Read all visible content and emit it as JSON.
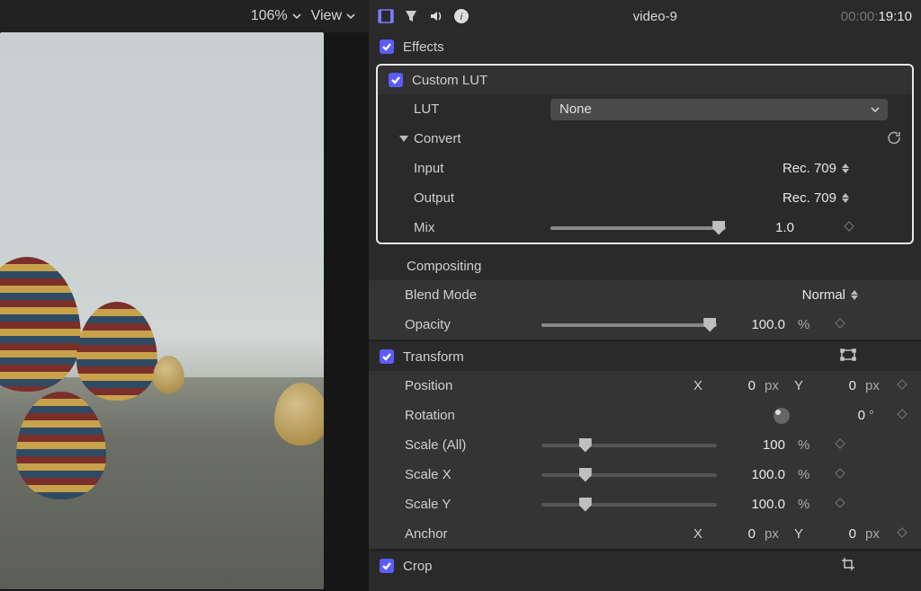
{
  "viewer": {
    "zoom": "106%",
    "view_label": "View"
  },
  "header": {
    "title": "video-9",
    "time_inactive": "00:00:",
    "time_active": "19:10"
  },
  "effects": {
    "section": "Effects",
    "custom_lut": {
      "title": "Custom LUT",
      "lut_label": "LUT",
      "lut_value": "None",
      "convert_label": "Convert",
      "input_label": "Input",
      "input_value": "Rec. 709",
      "output_label": "Output",
      "output_value": "Rec. 709",
      "mix_label": "Mix",
      "mix_value": "1.0"
    }
  },
  "compositing": {
    "title": "Compositing",
    "blend_label": "Blend Mode",
    "blend_value": "Normal",
    "opacity_label": "Opacity",
    "opacity_value": "100.0",
    "opacity_unit": "%"
  },
  "transform": {
    "title": "Transform",
    "position_label": "Position",
    "pos_x": "0",
    "pos_y": "0",
    "pos_unit": "px",
    "rotation_label": "Rotation",
    "rotation_value": "0",
    "rotation_unit": "°",
    "scale_all_label": "Scale (All)",
    "scale_all_value": "100",
    "scale_unit": "%",
    "scale_x_label": "Scale X",
    "scale_x_value": "100.0",
    "scale_y_label": "Scale Y",
    "scale_y_value": "100.0",
    "anchor_label": "Anchor",
    "anchor_x": "0",
    "anchor_y": "0"
  },
  "crop": {
    "title": "Crop"
  }
}
